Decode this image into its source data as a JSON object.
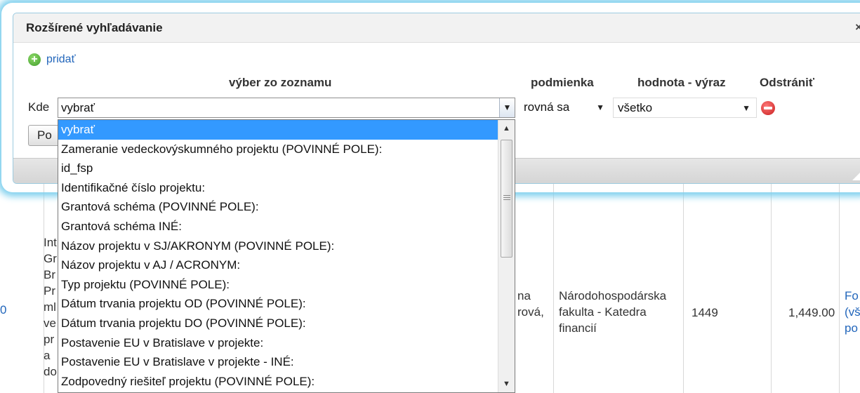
{
  "dialog": {
    "title": "Rozšírené vyhľadávanie",
    "close_label": "×",
    "add_label": "pridať",
    "headers": {
      "field": "výber zo zoznamu",
      "condition": "podmienka",
      "value": "hodnota - výraz",
      "remove": "Odstrániť"
    },
    "row": {
      "where_label": "Kde",
      "field_value": "vybrať",
      "condition_value": "rovná sa",
      "value_value": "všetko"
    },
    "search_button_label": "Po"
  },
  "dropdown": {
    "selected_index": 0,
    "options": [
      "vybrať",
      "Zameranie vedeckovýskumného projektu (POVINNÉ POLE):",
      "id_fsp",
      "Identifikačné číslo projektu:",
      "Grantová schéma (POVINNÉ POLE):",
      "Grantová schéma INÉ:",
      "Názov projektu v SJ/AKRONYM (POVINNÉ POLE):",
      "Názov projektu v AJ / ACRONYM:",
      "Typ projektu (POVINNÉ POLE):",
      "Dátum trvania projektu OD (POVINNÉ POLE):",
      "Dátum trvania projektu DO (POVINNÉ POLE):",
      "Postavenie EU v Bratislave v projekte:",
      "Postavenie EU v Bratislave v projekte - INÉ:",
      "Zodpovedný riešiteľ projektu (POVINNÉ POLE):"
    ]
  },
  "background_table": {
    "row_number": "0",
    "title_fragment": [
      "Int",
      "Gr",
      "Br",
      "Pr",
      "ml",
      "ve",
      "pr",
      "a",
      "do"
    ],
    "person_fragment": [
      "na",
      "rová,"
    ],
    "faculty": [
      "Národohospodárska",
      "fakulta - Katedra",
      "financií"
    ],
    "amount_a": "1449",
    "amount_b": "1,449.00",
    "link_fragment": [
      "Fo",
      "(vš",
      "po"
    ]
  }
}
